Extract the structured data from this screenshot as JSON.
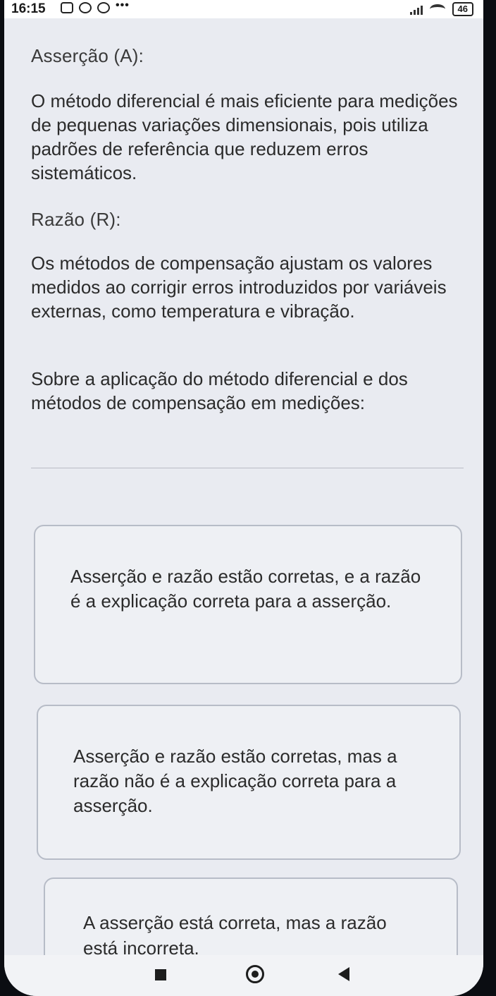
{
  "status_bar": {
    "time": "16:15",
    "battery": "46",
    "icons": [
      "image-icon",
      "facebook-icon",
      "app-icon",
      "more-dots-icon",
      "signal-icon",
      "wifi-icon",
      "battery-icon"
    ]
  },
  "question": {
    "assertion_heading": "Asserção (A):",
    "assertion_text": "O método diferencial é mais eficiente para medições de pequenas variações dimensionais, pois utiliza padrões de referência que reduzem erros sistemáticos.",
    "reason_heading": "Razão (R):",
    "reason_text": "Os métodos de compensação ajustam os valores medidos ao corrigir erros introduzidos por variáveis externas, como temperatura e vibração.",
    "prompt": "Sobre a aplicação do método diferencial e dos métodos de compensação em medições:"
  },
  "options": [
    {
      "label": "Asserção e razão estão corretas, e a razão é a explicação correta para a asserção."
    },
    {
      "label": "Asserção e razão estão corretas, mas a razão não é a explicação correta para a asserção."
    },
    {
      "label": "A asserção está correta, mas a razão está incorreta."
    }
  ],
  "nav_bar": {
    "buttons": [
      "recents-button",
      "home-button",
      "back-button"
    ]
  }
}
